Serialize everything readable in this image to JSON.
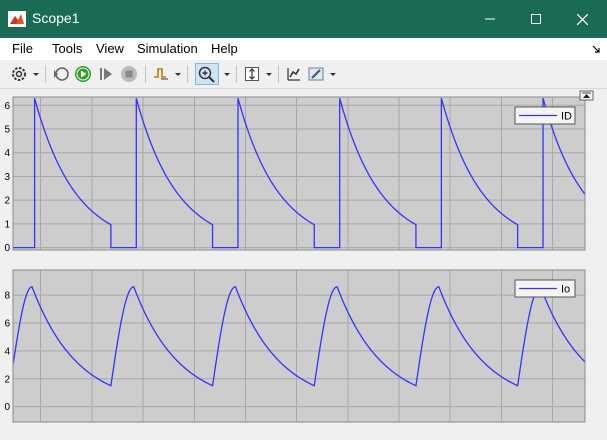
{
  "window": {
    "title": "Scope1",
    "bg_color": "#1a6b55"
  },
  "menu": {
    "items": [
      "File",
      "Tools",
      "View",
      "Simulation",
      "Help"
    ]
  },
  "toolbar": {
    "icons": [
      "settings-icon",
      "step-back-icon",
      "run-icon",
      "step-forward-icon",
      "stop-icon",
      "triggers-icon",
      "zoom-in-icon",
      "autoscale-icon",
      "cursor-measure-icon",
      "highlight-icon"
    ]
  },
  "colors": {
    "axes_bg": "#cdcdcd",
    "grid": "#a8a8a8",
    "trace": "#3333ff"
  },
  "chart_data": [
    {
      "type": "line",
      "title": "",
      "xlabel": "",
      "ylabel": "",
      "ytick_labels": [
        "0",
        "1",
        "2",
        "3",
        "4",
        "5",
        "6"
      ],
      "ylim": [
        -0.1,
        6.35
      ],
      "grid": true,
      "legend": "top-right",
      "series": [
        {
          "name": "ID"
        }
      ],
      "periodic_model": {
        "starts": [
          0.85,
          4.85,
          8.85,
          12.85,
          16.85,
          20.85
        ],
        "peak": 6.3,
        "tau": 1.6,
        "on_duration": 3.0,
        "trough": 1.34,
        "off_level": 0.0,
        "x_end": 22.5
      },
      "xlim": [
        0,
        22.5
      ]
    },
    {
      "type": "line",
      "title": "",
      "xlabel": "",
      "ylabel": "",
      "ytick_labels": [
        "0",
        "2",
        "4",
        "6",
        "8"
      ],
      "ylim": [
        -1.1,
        9.8
      ],
      "grid": true,
      "legend": "top-right",
      "series": [
        {
          "name": "Io"
        }
      ],
      "periodic_model": {
        "initial": 3.0,
        "cycle_period": 4.0,
        "rise_duration": 0.9,
        "peak": 8.6,
        "trough": 1.5,
        "x_end": 22.5,
        "first_rise_duration": 0.75
      },
      "xlim": [
        0,
        22.5
      ]
    }
  ]
}
